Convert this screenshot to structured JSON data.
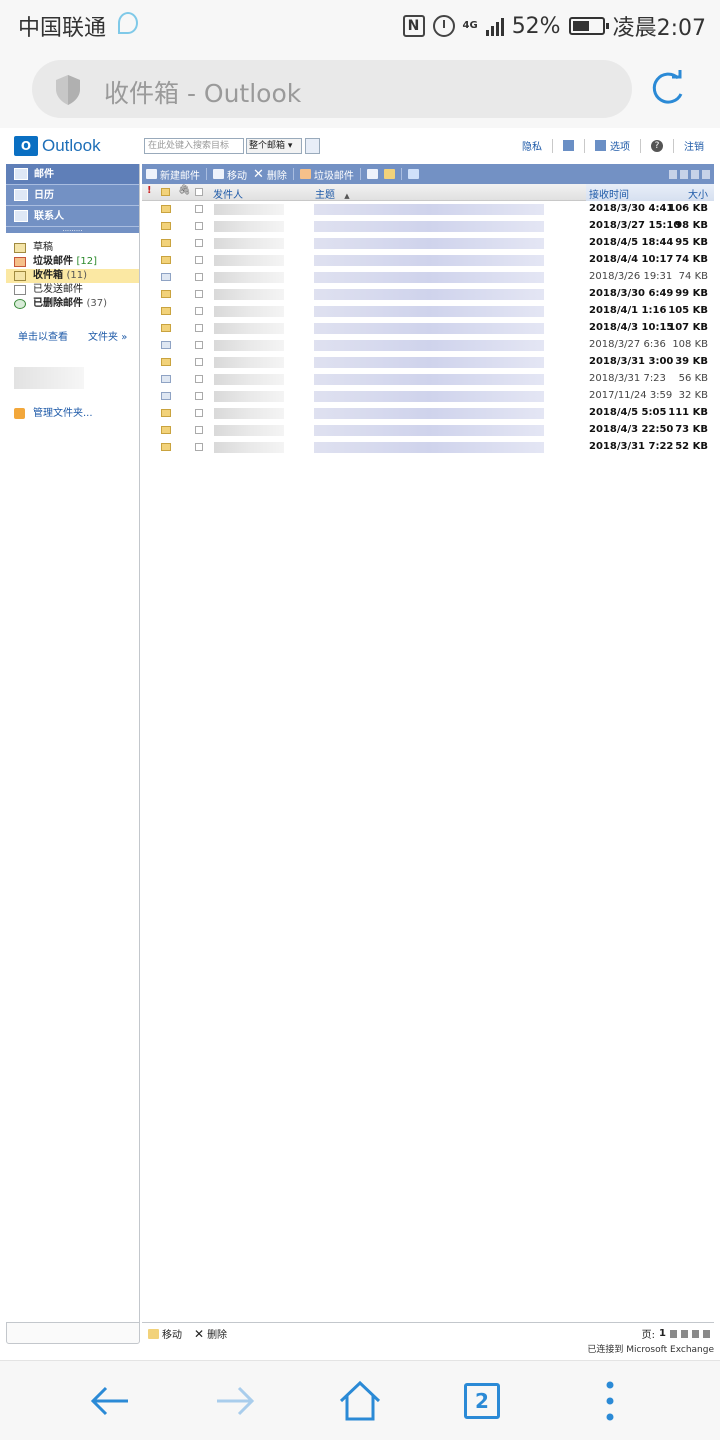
{
  "status_bar": {
    "carrier": "中国联通",
    "network": "4G",
    "battery": "52%",
    "time": "凌晨2:07"
  },
  "browser": {
    "url_title": "收件箱 - Outlook",
    "tab_count": "2"
  },
  "owa": {
    "logo_text": "Outlook",
    "search_placeholder": "在此处键入搜索目标",
    "search_scope": "整个邮箱",
    "top_links": {
      "privacy": "隐私",
      "options": "选项",
      "signout": "注销"
    },
    "nav": [
      {
        "label": "邮件"
      },
      {
        "label": "日历"
      },
      {
        "label": "联系人"
      }
    ],
    "folders": [
      {
        "name": "草稿",
        "count": ""
      },
      {
        "name": "垃圾邮件",
        "count": "[12]"
      },
      {
        "name": "收件箱",
        "count": "(11)"
      },
      {
        "name": "已发送邮件",
        "count": ""
      },
      {
        "name": "已删除邮件",
        "count": "(37)"
      }
    ],
    "view_more_folders": "单击以查看",
    "view_more_folders_tail": "文件夹",
    "manage_folders": "管理文件夹...",
    "toolbar": {
      "new_mail": "新建邮件",
      "move": "移动",
      "delete": "删除",
      "junk": "垃圾邮件"
    },
    "columns": {
      "from": "发件人",
      "subject": "主题",
      "received": "接收时间",
      "size": "大小"
    },
    "messages": [
      {
        "date": "2018/3/30 4:41",
        "size": "106 KB",
        "unread": true
      },
      {
        "date": "2018/3/27 15:10",
        "size": "98 KB",
        "unread": true
      },
      {
        "date": "2018/4/5 18:44",
        "size": "95 KB",
        "unread": true
      },
      {
        "date": "2018/4/4 10:17",
        "size": "74 KB",
        "unread": true
      },
      {
        "date": "2018/3/26 19:31",
        "size": "74 KB",
        "unread": false
      },
      {
        "date": "2018/3/30 6:49",
        "size": "99 KB",
        "unread": true
      },
      {
        "date": "2018/4/1 1:16",
        "size": "105 KB",
        "unread": true
      },
      {
        "date": "2018/4/3 10:15",
        "size": "107 KB",
        "unread": true
      },
      {
        "date": "2018/3/27 6:36",
        "size": "108 KB",
        "unread": false
      },
      {
        "date": "2018/3/31 3:00",
        "size": "39 KB",
        "unread": true
      },
      {
        "date": "2018/3/31 7:23",
        "size": "56 KB",
        "unread": false
      },
      {
        "date": "2017/11/24 3:59",
        "size": "32 KB",
        "unread": false
      },
      {
        "date": "2018/4/5 5:05",
        "size": "111 KB",
        "unread": true
      },
      {
        "date": "2018/4/3 22:50",
        "size": "73 KB",
        "unread": true
      },
      {
        "date": "2018/3/31 7:22",
        "size": "52 KB",
        "unread": true
      }
    ],
    "footer": {
      "move": "移动",
      "delete": "删除",
      "page_label": "页:",
      "page_number": "1"
    },
    "connected_text": "已连接到 Microsoft Exchange"
  }
}
